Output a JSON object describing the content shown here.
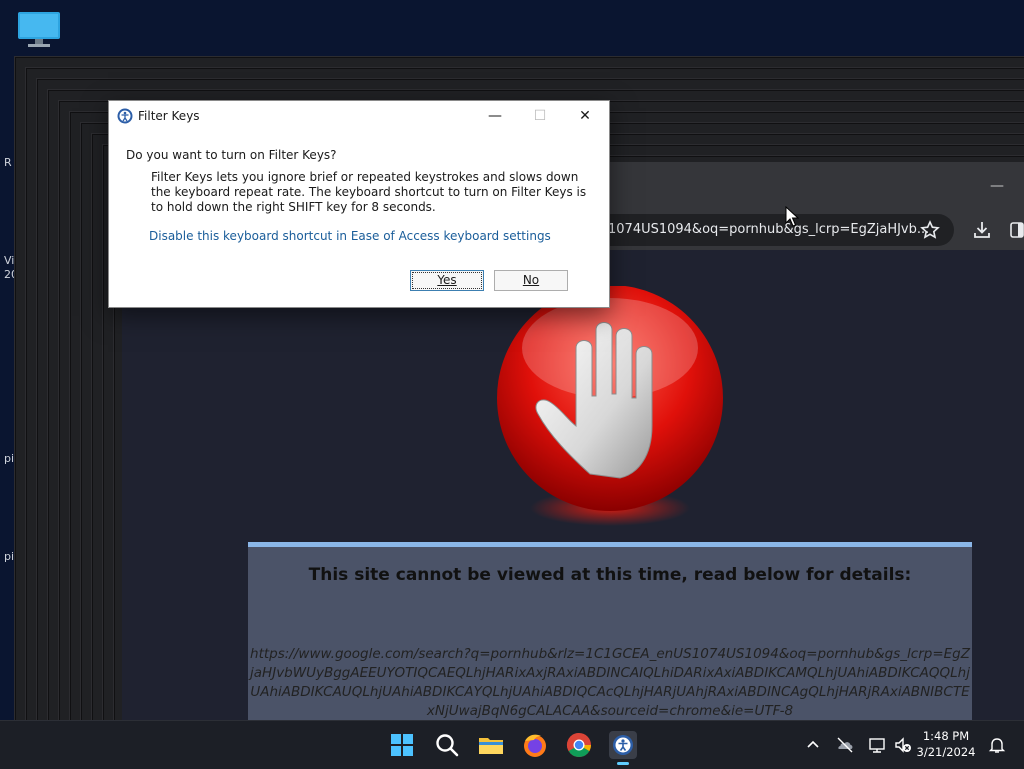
{
  "desktop": {
    "side_fragments": [
      "R",
      "Vi",
      "20",
      "pi",
      "pi"
    ]
  },
  "browser": {
    "minimize_glyph": "—",
    "address_bar_text": "1074US1094&oq=pornhub&gs_lcrp=EgZjaHJvb...",
    "page": {
      "heading": "This site cannot be viewed at this time, read below for details:",
      "blocked_url": "https://www.google.com/search?q=pornhub&rlz=1C1GCEA_enUS1074US1094&oq=pornhub&gs_lcrp=EgZjaHJvbWUyBggAEEUYOTIQCAEQLhjHARixAxjRAxiABDINCAIQLhiDARixAxiABDIKCAMQLhjUAhiABDIKCAQQLhjUAhiABDIKCAUQLhjUAhiABDIKCAYQLhjUAhiABDIQCAcQLhjHARjUAhjRAxiABDINCAgQLhjHARjRAxiABNIBCTExNjUwajBqN6gCALACAA&sourceid=chrome&ie=UTF-8"
    }
  },
  "dialog": {
    "title": "Filter Keys",
    "question": "Do you want to turn on Filter Keys?",
    "description": "Filter Keys lets you ignore brief or repeated keystrokes and slows down the keyboard repeat rate.  The keyboard shortcut to turn on Filter Keys is to hold down the right SHIFT key for 8 seconds.",
    "link": "Disable this keyboard shortcut in Ease of Access keyboard settings",
    "yes_label": "Yes",
    "no_label": "No",
    "minimize_glyph": "—",
    "maximize_glyph": "☐",
    "close_glyph": "✕"
  },
  "taskbar": {
    "time": "1:48 PM",
    "date": "3/21/2024",
    "apps": [
      "start-icon",
      "search-icon",
      "file-explorer-icon",
      "firefox-icon",
      "chrome-icon",
      "app-icon"
    ],
    "accent": "#60cdff"
  },
  "colors": {
    "desktop": "#0a1530",
    "browser_frame": "#35363a",
    "notice_bg": "#4b5368",
    "notice_border": "#8bb7e8",
    "link": "#1a5d9a"
  }
}
